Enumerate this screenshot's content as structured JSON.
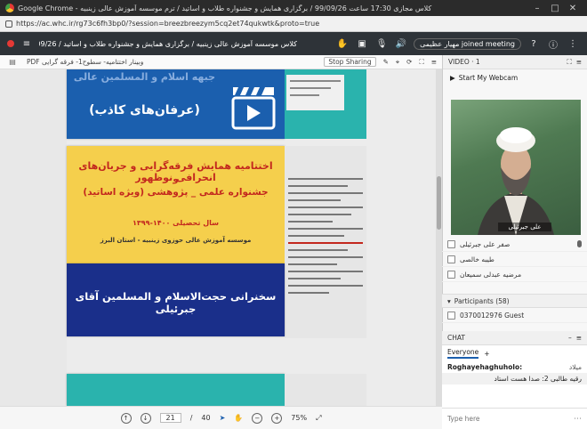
{
  "browser": {
    "window_title": "Google Chrome - کلاس مجازی 17:30 ساعت 99/09/26 / برگزاری همایش و جشنواره طلاب و اساتید / ترم موسسه آموزش عالی زینبیه",
    "url": "https://ac.whc.ir/rg73c6fh3bp0/?session=breezbreezym5cq2et74qukwtk&proto=true"
  },
  "toolbar": {
    "meeting_title": "کلاس موسسه آموزش عالی زینبیه / برگزاری همایش و جشنواره طلاب و اساتید / 99/09/26 ساعت 17:30",
    "user_status": "مهیار عظیمی joined meeting"
  },
  "presentation": {
    "file_label": "PDF وبینار اختتامیه- سطوح1- فرقه گرایی",
    "stop_sharing": "Stop Sharing",
    "current_page": "21",
    "total_pages": "40",
    "page_separator": "/",
    "zoom": "75%"
  },
  "slides": {
    "top_banner": "(عرفان‌های کاذب)",
    "top_banner_title": "جبهه اسلام و المسلمین عالی",
    "main_title": "اختتامیه همایش فرقه‌گرایی و جریان‌های انحرافی نوظهور",
    "main_title_2": "و",
    "main_title_3": "جشنواره علمی _ پژوهشی (ویژه اساتید)",
    "year": "سال تحصیلی ۱۴۰۰-۱۳۹۹",
    "institute": "موسسه آموزش عالی حوزوی زینبیه - استان البرز",
    "speaker": "سخنرانی حجت‌الاسلام و المسلمین آقای جبرئیلی"
  },
  "video": {
    "header": "VIDEO · 1",
    "start_webcam": "Start My Webcam",
    "name_tag": "علی جبرئیلی"
  },
  "attendees": [
    {
      "name": "صفر علی جبرئیلی"
    },
    {
      "name": "طیبه خالصی"
    },
    {
      "name": "مرضیه عبدلی سمیعان"
    }
  ],
  "participants": {
    "label": "Participants (58)",
    "guest": "0370012976 Guest"
  },
  "chat": {
    "header": "CHAT",
    "audience": "Everyone",
    "messages": [
      {
        "sender": "Roghayehaghuholo:",
        "text": "میلاد"
      },
      {
        "sender": "",
        "text": "رقیه طالبی 2: صدا هست استاد"
      }
    ],
    "placeholder": "Type here"
  },
  "colors": {
    "slide_blue": "#1b5fae",
    "slide_yellow": "#f5cf4c",
    "slide_navy": "#1a2f8a",
    "slide_teal": "#2ab3ad",
    "title_red": "#c3281e"
  }
}
